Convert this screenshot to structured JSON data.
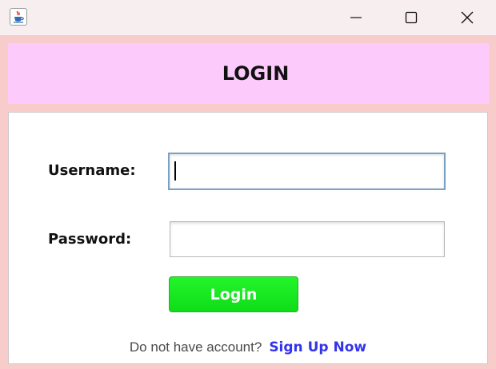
{
  "window": {
    "title": "",
    "app_icon": "java-coffee-cup-icon",
    "controls": {
      "minimize_icon": "minimize-icon",
      "maximize_icon": "maximize-icon",
      "close_icon": "close-icon"
    }
  },
  "header": {
    "title": "LOGIN",
    "background": "#fccbfc"
  },
  "form": {
    "username_label": "Username:",
    "username_value": "",
    "password_label": "Password:",
    "password_value": "",
    "login_button_label": "Login",
    "login_button_color": "#1bec22"
  },
  "footer": {
    "prompt": "Do not have account?",
    "signup_link": "Sign Up Now",
    "signup_color": "#3333ee"
  },
  "colors": {
    "frame_background": "#f9cccc",
    "titlebar_background": "#f7efef"
  }
}
